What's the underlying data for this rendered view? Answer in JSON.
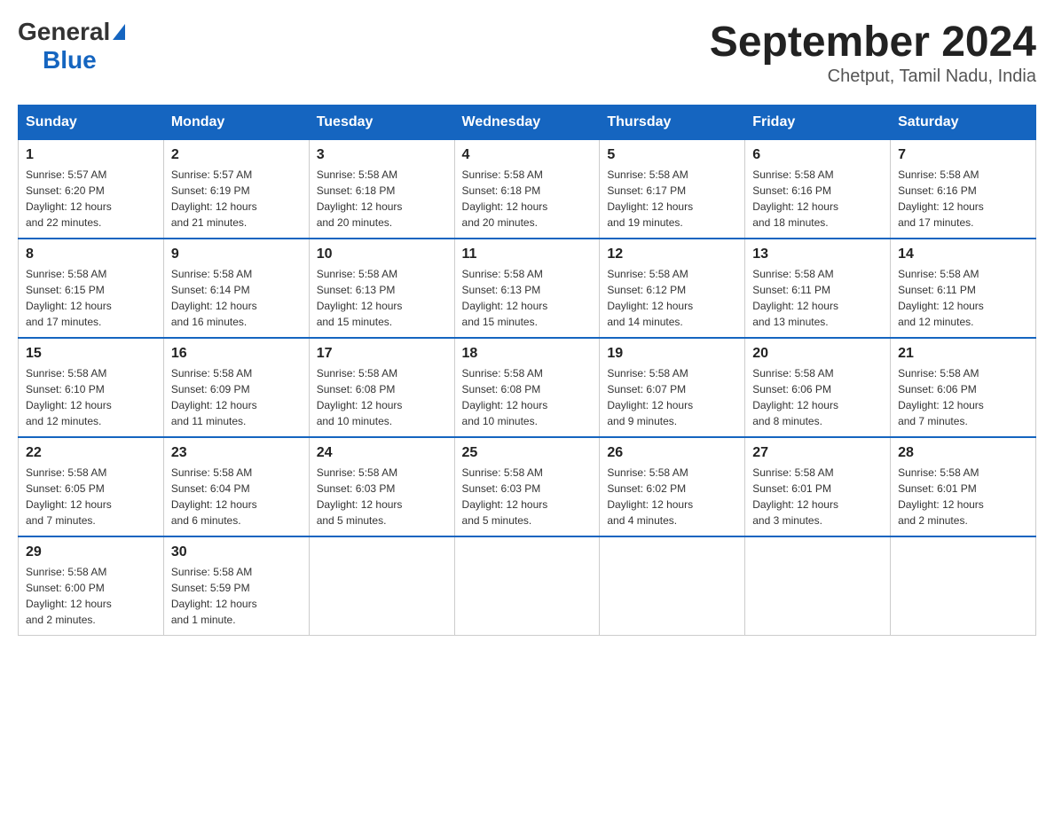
{
  "header": {
    "logo_general": "General",
    "logo_blue": "Blue",
    "month_year": "September 2024",
    "location": "Chetput, Tamil Nadu, India"
  },
  "weekdays": [
    "Sunday",
    "Monday",
    "Tuesday",
    "Wednesday",
    "Thursday",
    "Friday",
    "Saturday"
  ],
  "weeks": [
    [
      {
        "day": "1",
        "sunrise": "5:57 AM",
        "sunset": "6:20 PM",
        "daylight": "12 hours and 22 minutes."
      },
      {
        "day": "2",
        "sunrise": "5:57 AM",
        "sunset": "6:19 PM",
        "daylight": "12 hours and 21 minutes."
      },
      {
        "day": "3",
        "sunrise": "5:58 AM",
        "sunset": "6:18 PM",
        "daylight": "12 hours and 20 minutes."
      },
      {
        "day": "4",
        "sunrise": "5:58 AM",
        "sunset": "6:18 PM",
        "daylight": "12 hours and 20 minutes."
      },
      {
        "day": "5",
        "sunrise": "5:58 AM",
        "sunset": "6:17 PM",
        "daylight": "12 hours and 19 minutes."
      },
      {
        "day": "6",
        "sunrise": "5:58 AM",
        "sunset": "6:16 PM",
        "daylight": "12 hours and 18 minutes."
      },
      {
        "day": "7",
        "sunrise": "5:58 AM",
        "sunset": "6:16 PM",
        "daylight": "12 hours and 17 minutes."
      }
    ],
    [
      {
        "day": "8",
        "sunrise": "5:58 AM",
        "sunset": "6:15 PM",
        "daylight": "12 hours and 17 minutes."
      },
      {
        "day": "9",
        "sunrise": "5:58 AM",
        "sunset": "6:14 PM",
        "daylight": "12 hours and 16 minutes."
      },
      {
        "day": "10",
        "sunrise": "5:58 AM",
        "sunset": "6:13 PM",
        "daylight": "12 hours and 15 minutes."
      },
      {
        "day": "11",
        "sunrise": "5:58 AM",
        "sunset": "6:13 PM",
        "daylight": "12 hours and 15 minutes."
      },
      {
        "day": "12",
        "sunrise": "5:58 AM",
        "sunset": "6:12 PM",
        "daylight": "12 hours and 14 minutes."
      },
      {
        "day": "13",
        "sunrise": "5:58 AM",
        "sunset": "6:11 PM",
        "daylight": "12 hours and 13 minutes."
      },
      {
        "day": "14",
        "sunrise": "5:58 AM",
        "sunset": "6:11 PM",
        "daylight": "12 hours and 12 minutes."
      }
    ],
    [
      {
        "day": "15",
        "sunrise": "5:58 AM",
        "sunset": "6:10 PM",
        "daylight": "12 hours and 12 minutes."
      },
      {
        "day": "16",
        "sunrise": "5:58 AM",
        "sunset": "6:09 PM",
        "daylight": "12 hours and 11 minutes."
      },
      {
        "day": "17",
        "sunrise": "5:58 AM",
        "sunset": "6:08 PM",
        "daylight": "12 hours and 10 minutes."
      },
      {
        "day": "18",
        "sunrise": "5:58 AM",
        "sunset": "6:08 PM",
        "daylight": "12 hours and 10 minutes."
      },
      {
        "day": "19",
        "sunrise": "5:58 AM",
        "sunset": "6:07 PM",
        "daylight": "12 hours and 9 minutes."
      },
      {
        "day": "20",
        "sunrise": "5:58 AM",
        "sunset": "6:06 PM",
        "daylight": "12 hours and 8 minutes."
      },
      {
        "day": "21",
        "sunrise": "5:58 AM",
        "sunset": "6:06 PM",
        "daylight": "12 hours and 7 minutes."
      }
    ],
    [
      {
        "day": "22",
        "sunrise": "5:58 AM",
        "sunset": "6:05 PM",
        "daylight": "12 hours and 7 minutes."
      },
      {
        "day": "23",
        "sunrise": "5:58 AM",
        "sunset": "6:04 PM",
        "daylight": "12 hours and 6 minutes."
      },
      {
        "day": "24",
        "sunrise": "5:58 AM",
        "sunset": "6:03 PM",
        "daylight": "12 hours and 5 minutes."
      },
      {
        "day": "25",
        "sunrise": "5:58 AM",
        "sunset": "6:03 PM",
        "daylight": "12 hours and 5 minutes."
      },
      {
        "day": "26",
        "sunrise": "5:58 AM",
        "sunset": "6:02 PM",
        "daylight": "12 hours and 4 minutes."
      },
      {
        "day": "27",
        "sunrise": "5:58 AM",
        "sunset": "6:01 PM",
        "daylight": "12 hours and 3 minutes."
      },
      {
        "day": "28",
        "sunrise": "5:58 AM",
        "sunset": "6:01 PM",
        "daylight": "12 hours and 2 minutes."
      }
    ],
    [
      {
        "day": "29",
        "sunrise": "5:58 AM",
        "sunset": "6:00 PM",
        "daylight": "12 hours and 2 minutes."
      },
      {
        "day": "30",
        "sunrise": "5:58 AM",
        "sunset": "5:59 PM",
        "daylight": "12 hours and 1 minute."
      },
      null,
      null,
      null,
      null,
      null
    ]
  ],
  "labels": {
    "sunrise_prefix": "Sunrise: ",
    "sunset_prefix": "Sunset: ",
    "daylight_prefix": "Daylight: "
  }
}
